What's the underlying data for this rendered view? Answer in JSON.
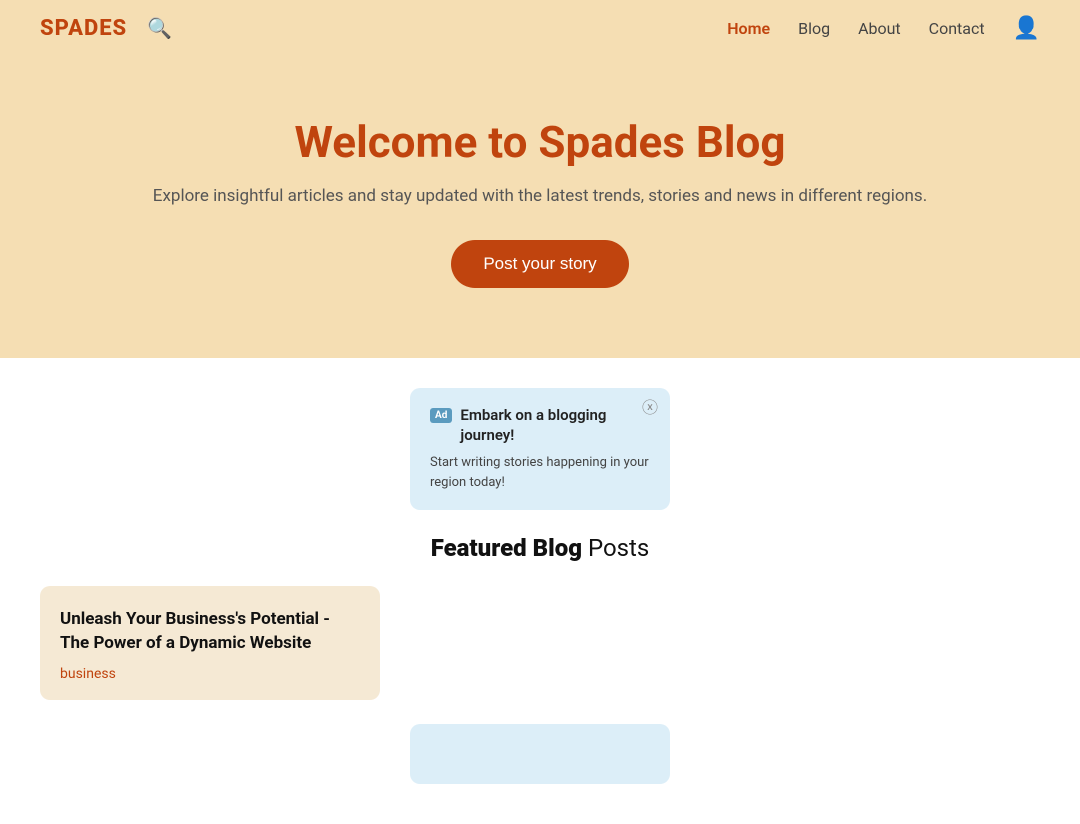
{
  "nav": {
    "logo_text": "SP",
    "logo_spade": "♠",
    "logo_full": "SPADES",
    "links": [
      {
        "label": "Home",
        "active": true
      },
      {
        "label": "Blog",
        "active": false
      },
      {
        "label": "About",
        "active": false
      },
      {
        "label": "Contact",
        "active": false
      }
    ]
  },
  "hero": {
    "title": "Welcome to Spades Blog",
    "subtitle": "Explore insightful articles and stay updated with the latest trends, stories and news in different regions.",
    "cta_label": "Post your story"
  },
  "ad": {
    "badge": "Ad",
    "title": "Embark on a blogging journey!",
    "description": "Start writing stories happening in your region today!"
  },
  "featured": {
    "heading_bold": "Featured Blog",
    "heading_normal": " Posts"
  },
  "blog_card": {
    "title": "Unleash Your Business's Potential - The Power of a Dynamic Website",
    "tag": "business"
  }
}
